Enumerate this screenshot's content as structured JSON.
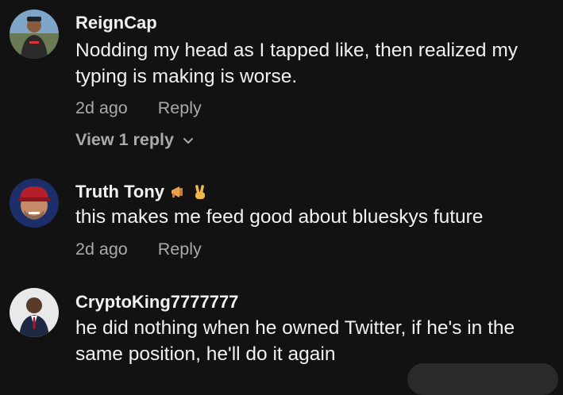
{
  "comments": [
    {
      "username": "ReignCap",
      "text": "Nodding my head as I tapped like, then realized my typing is making is worse.",
      "time": "2d ago",
      "reply_label": "Reply",
      "view_replies": "View 1 reply"
    },
    {
      "username": "Truth Tony",
      "text": "this makes me feed good about blueskys future",
      "time": "2d ago",
      "reply_label": "Reply",
      "badges": [
        "megaphone-emoji",
        "victory-hand-emoji"
      ]
    },
    {
      "username": "CryptoKing7777777",
      "text": "he did nothing when he owned Twitter, if he's in the same position, he'll do it again"
    }
  ],
  "colors": {
    "background": "#121212",
    "primary_text": "#f1f1f1",
    "secondary_text": "#aaaaaa"
  }
}
